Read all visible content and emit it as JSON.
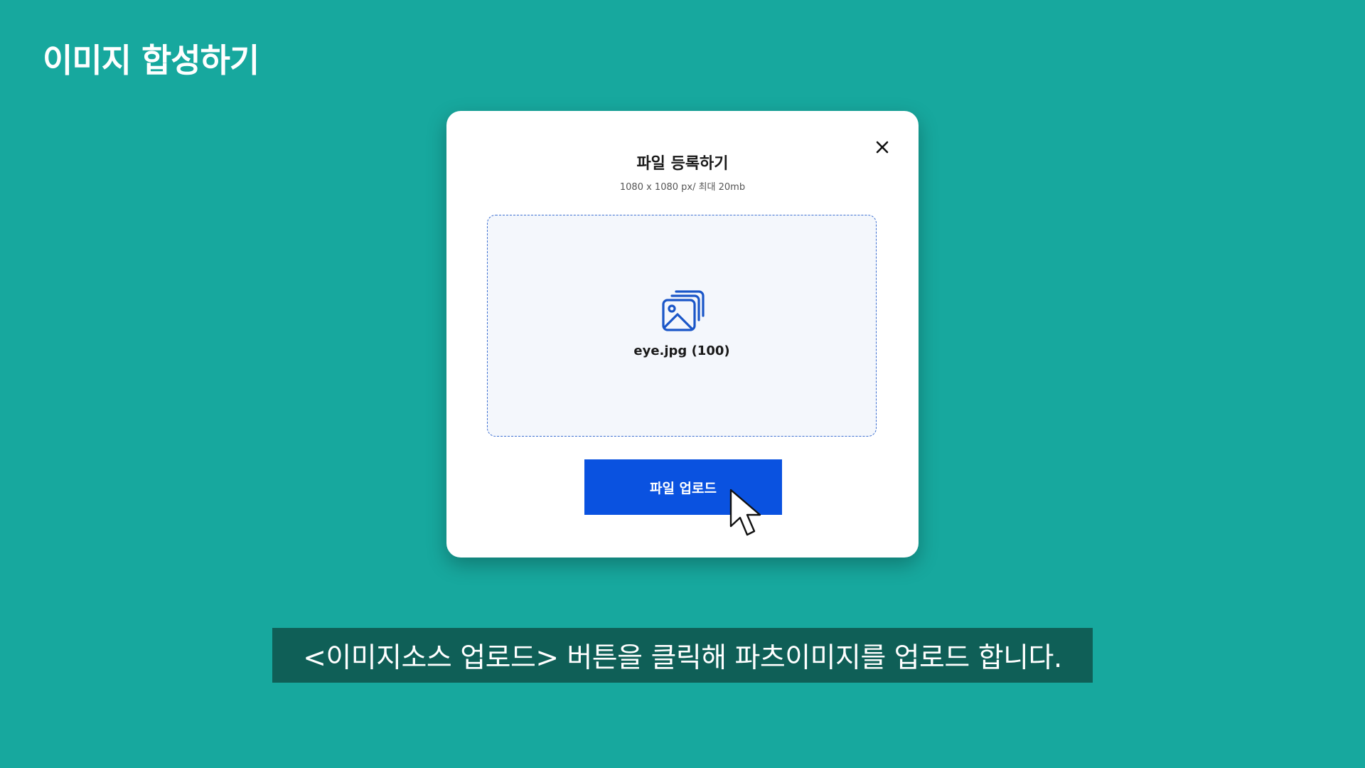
{
  "page": {
    "title": "이미지 합성하기"
  },
  "modal": {
    "title": "파일 등록하기",
    "subtitle": "1080 x 1080 px/ 최대 20mb",
    "close_icon": "close-icon",
    "dropzone": {
      "icon": "images-stack-icon",
      "file_name": "eye.jpg (100)"
    },
    "upload_button_label": "파일 업로드"
  },
  "caption": {
    "text": "<이미지소스 업로드> 버튼을 클릭해 파츠이미지를 업로드 합니다."
  },
  "colors": {
    "background": "#17a89e",
    "caption_bg": "#0f5f57",
    "button": "#0a52e0",
    "dropzone_bg": "#f4f7fc",
    "dropzone_border": "#3d6fd1",
    "icon": "#1a56c8"
  }
}
